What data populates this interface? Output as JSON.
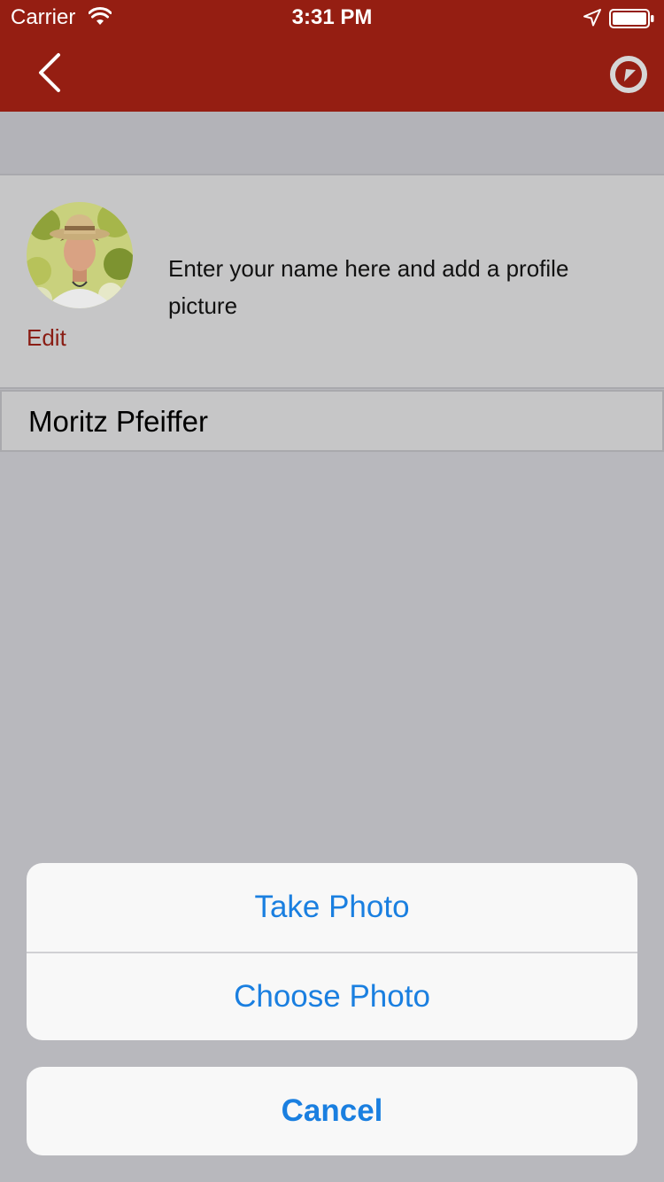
{
  "status_bar": {
    "carrier": "Carrier",
    "time": "3:31 PM",
    "icons": [
      "wifi-icon",
      "location-arrow-icon",
      "battery-icon"
    ]
  },
  "nav_bar": {
    "background_color": "#951e12",
    "left_icon": "chevron-left-icon",
    "right_icon": "compass-icon"
  },
  "profile": {
    "avatar_icon": "profile-photo",
    "edit_label": "Edit",
    "hint": "Enter your name here and add a profile picture",
    "accent_color": "#8a1d14"
  },
  "name_field": {
    "value": "Moritz Pfeiffer"
  },
  "action_sheet": {
    "actions": [
      {
        "label": "Take Photo"
      },
      {
        "label": "Choose Photo"
      }
    ],
    "cancel_label": "Cancel",
    "text_color": "#1a7fe0"
  }
}
